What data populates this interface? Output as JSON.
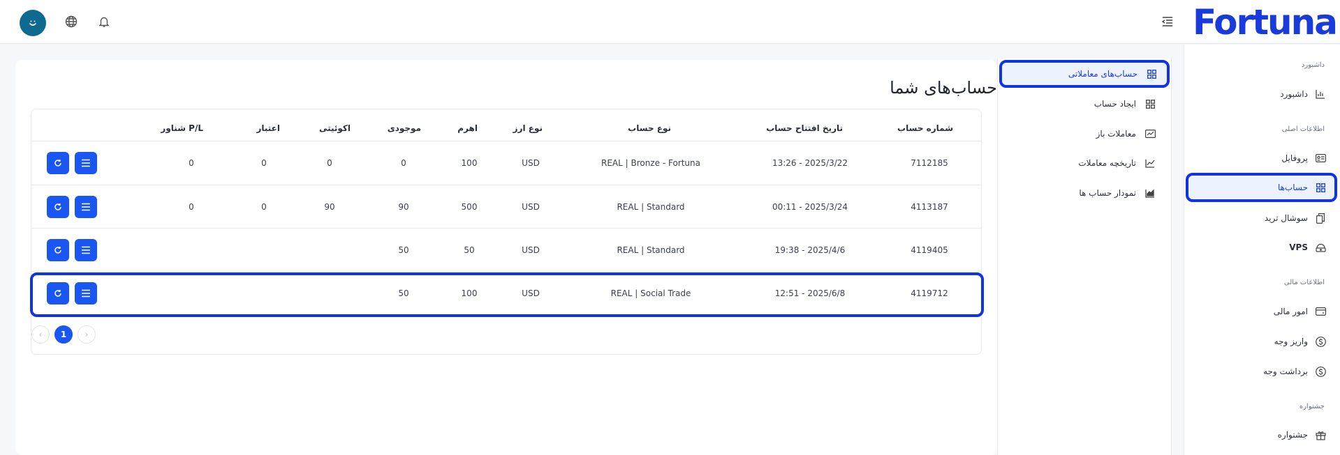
{
  "brand": {
    "logo_text": "Fortuna",
    "color": "#1a3bdb"
  },
  "header": {
    "avatar_icon": "smiley-icon",
    "globe_icon": "globe-icon",
    "bell_icon": "bell-icon",
    "menu_icon": "menu-collapse-icon"
  },
  "sidebar": {
    "sections": {
      "dashboard": "داشبورد",
      "main_info": "اطلاعات اصلی",
      "financial_info": "اطلاعات مالی",
      "festival": "جشنواره"
    },
    "items": [
      {
        "label": "داشبورد",
        "icon": "chart-icon"
      },
      {
        "label": "پروفایل",
        "icon": "id-card-icon"
      },
      {
        "label": "حساب‌ها",
        "icon": "grid-icon",
        "active": true
      },
      {
        "label": "سوشال ترید",
        "icon": "copy-icon"
      },
      {
        "label": "VPS",
        "icon": "server-icon"
      },
      {
        "label": "امور مالی",
        "icon": "wallet-icon"
      },
      {
        "label": "واریز وجه",
        "icon": "dollar-icon"
      },
      {
        "label": "برداشت وجه",
        "icon": "dollar-icon"
      },
      {
        "label": "جشنواره",
        "icon": "gift-icon"
      }
    ]
  },
  "subnav": {
    "items": [
      {
        "label": "حساب‌های معاملاتی",
        "icon": "grid-icon",
        "active": true
      },
      {
        "label": "ایجاد حساب",
        "icon": "grid-icon"
      },
      {
        "label": "معاملات باز",
        "icon": "chart-line-icon"
      },
      {
        "label": "تاریخچه معاملات",
        "icon": "chart-line-icon"
      },
      {
        "label": "نمودار حساب ها",
        "icon": "area-chart-icon"
      }
    ]
  },
  "main": {
    "title": "حساب‌های شما",
    "columns": {
      "account_number": "شماره حساب",
      "open_date": "تاریخ افتتاح حساب",
      "account_type": "نوع حساب",
      "currency": "نوع ارز",
      "leverage": "اهرم",
      "balance": "موجودی",
      "equity": "اکوئیتی",
      "credit": "اعتبار",
      "floating_pl": "P/L شناور"
    },
    "rows": [
      {
        "account_number": "7112185",
        "open_date": "13:26 - 2025/3/22",
        "account_type": "REAL | Bronze - Fortuna",
        "currency": "USD",
        "leverage": "100",
        "balance": "0",
        "equity": "0",
        "credit": "0",
        "floating_pl": "0"
      },
      {
        "account_number": "4113187",
        "open_date": "00:11 - 2025/3/24",
        "account_type": "REAL | Standard",
        "currency": "USD",
        "leverage": "500",
        "balance": "90",
        "equity": "90",
        "credit": "0",
        "floating_pl": "0"
      },
      {
        "account_number": "4119405",
        "open_date": "19:38 - 2025/4/6",
        "account_type": "REAL | Standard",
        "currency": "USD",
        "leverage": "50",
        "balance": "50",
        "equity": "",
        "credit": "",
        "floating_pl": ""
      },
      {
        "account_number": "4119712",
        "open_date": "12:51 - 2025/6/8",
        "account_type": "REAL | Social Trade",
        "currency": "USD",
        "leverage": "100",
        "balance": "50",
        "equity": "",
        "credit": "",
        "floating_pl": ""
      }
    ],
    "pagination": {
      "current": "1",
      "prev_icon": "chevron-left-icon",
      "next_icon": "chevron-right-icon"
    }
  }
}
